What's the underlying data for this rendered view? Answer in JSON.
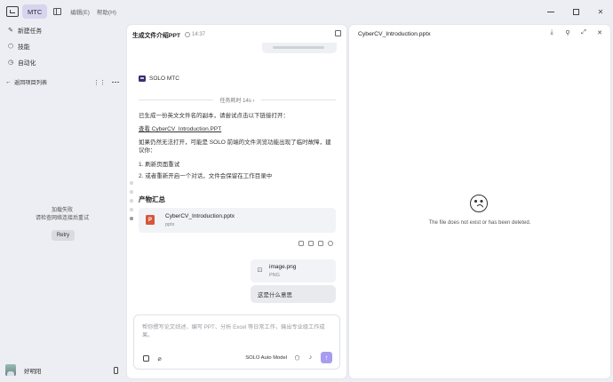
{
  "titlebar": {
    "app_name": "MTC",
    "menu": [
      "编辑(E)",
      "帮助(H)"
    ],
    "controls": [
      "minimize",
      "maximize",
      "close"
    ]
  },
  "sidebar": {
    "items": [
      {
        "label": "新建任务",
        "icon": "edit-icon"
      },
      {
        "label": "技能",
        "icon": "skills-icon"
      },
      {
        "label": "自动化",
        "icon": "clock-icon"
      }
    ],
    "back_label": "返回项目列表",
    "error_line1": "加载失败",
    "error_line2": "请检查网络连接后重试",
    "retry_label": "Retry",
    "user_name": "好明阳"
  },
  "chat": {
    "title": "生成文件介绍PPT",
    "time": "14:37",
    "bot_name": "SOLO MTC",
    "task_duration": "任务耗时 14s ›",
    "line1": "已生成一份英文文件名的副本，请尝试点击以下链接打开：",
    "link": "查看 CyberCV_Introduction.PPT",
    "line2": "如果仍然无法打开，可能是 SOLO 前端的文件浏览功能出现了临时故障，建议你：",
    "step1": "1. 刷新页面重试",
    "step2": "2. 或者重新开启一个对话，文件会保留在工作目录中",
    "output_heading": "产物汇总",
    "file_name": "CyberCV_Introduction.pptx",
    "file_ext": "pptx",
    "image_name": "image.png",
    "image_ext": "PNG",
    "user_message": "这是什么意思",
    "input_placeholder": "帮你撰写论文综述、编写 PPT、分析 Excel 等日常工作，输出专业级工作成果。",
    "model_name": "SOLO Auto Model"
  },
  "preview": {
    "title": "CyberCV_Introduction.pptx",
    "message": "The file does not exist or has been deleted."
  },
  "colors": {
    "accent": "#a89cf0",
    "app_badge": "#d7d4ef",
    "ppt_icon": "#d7563a",
    "background": "#eceef3"
  }
}
